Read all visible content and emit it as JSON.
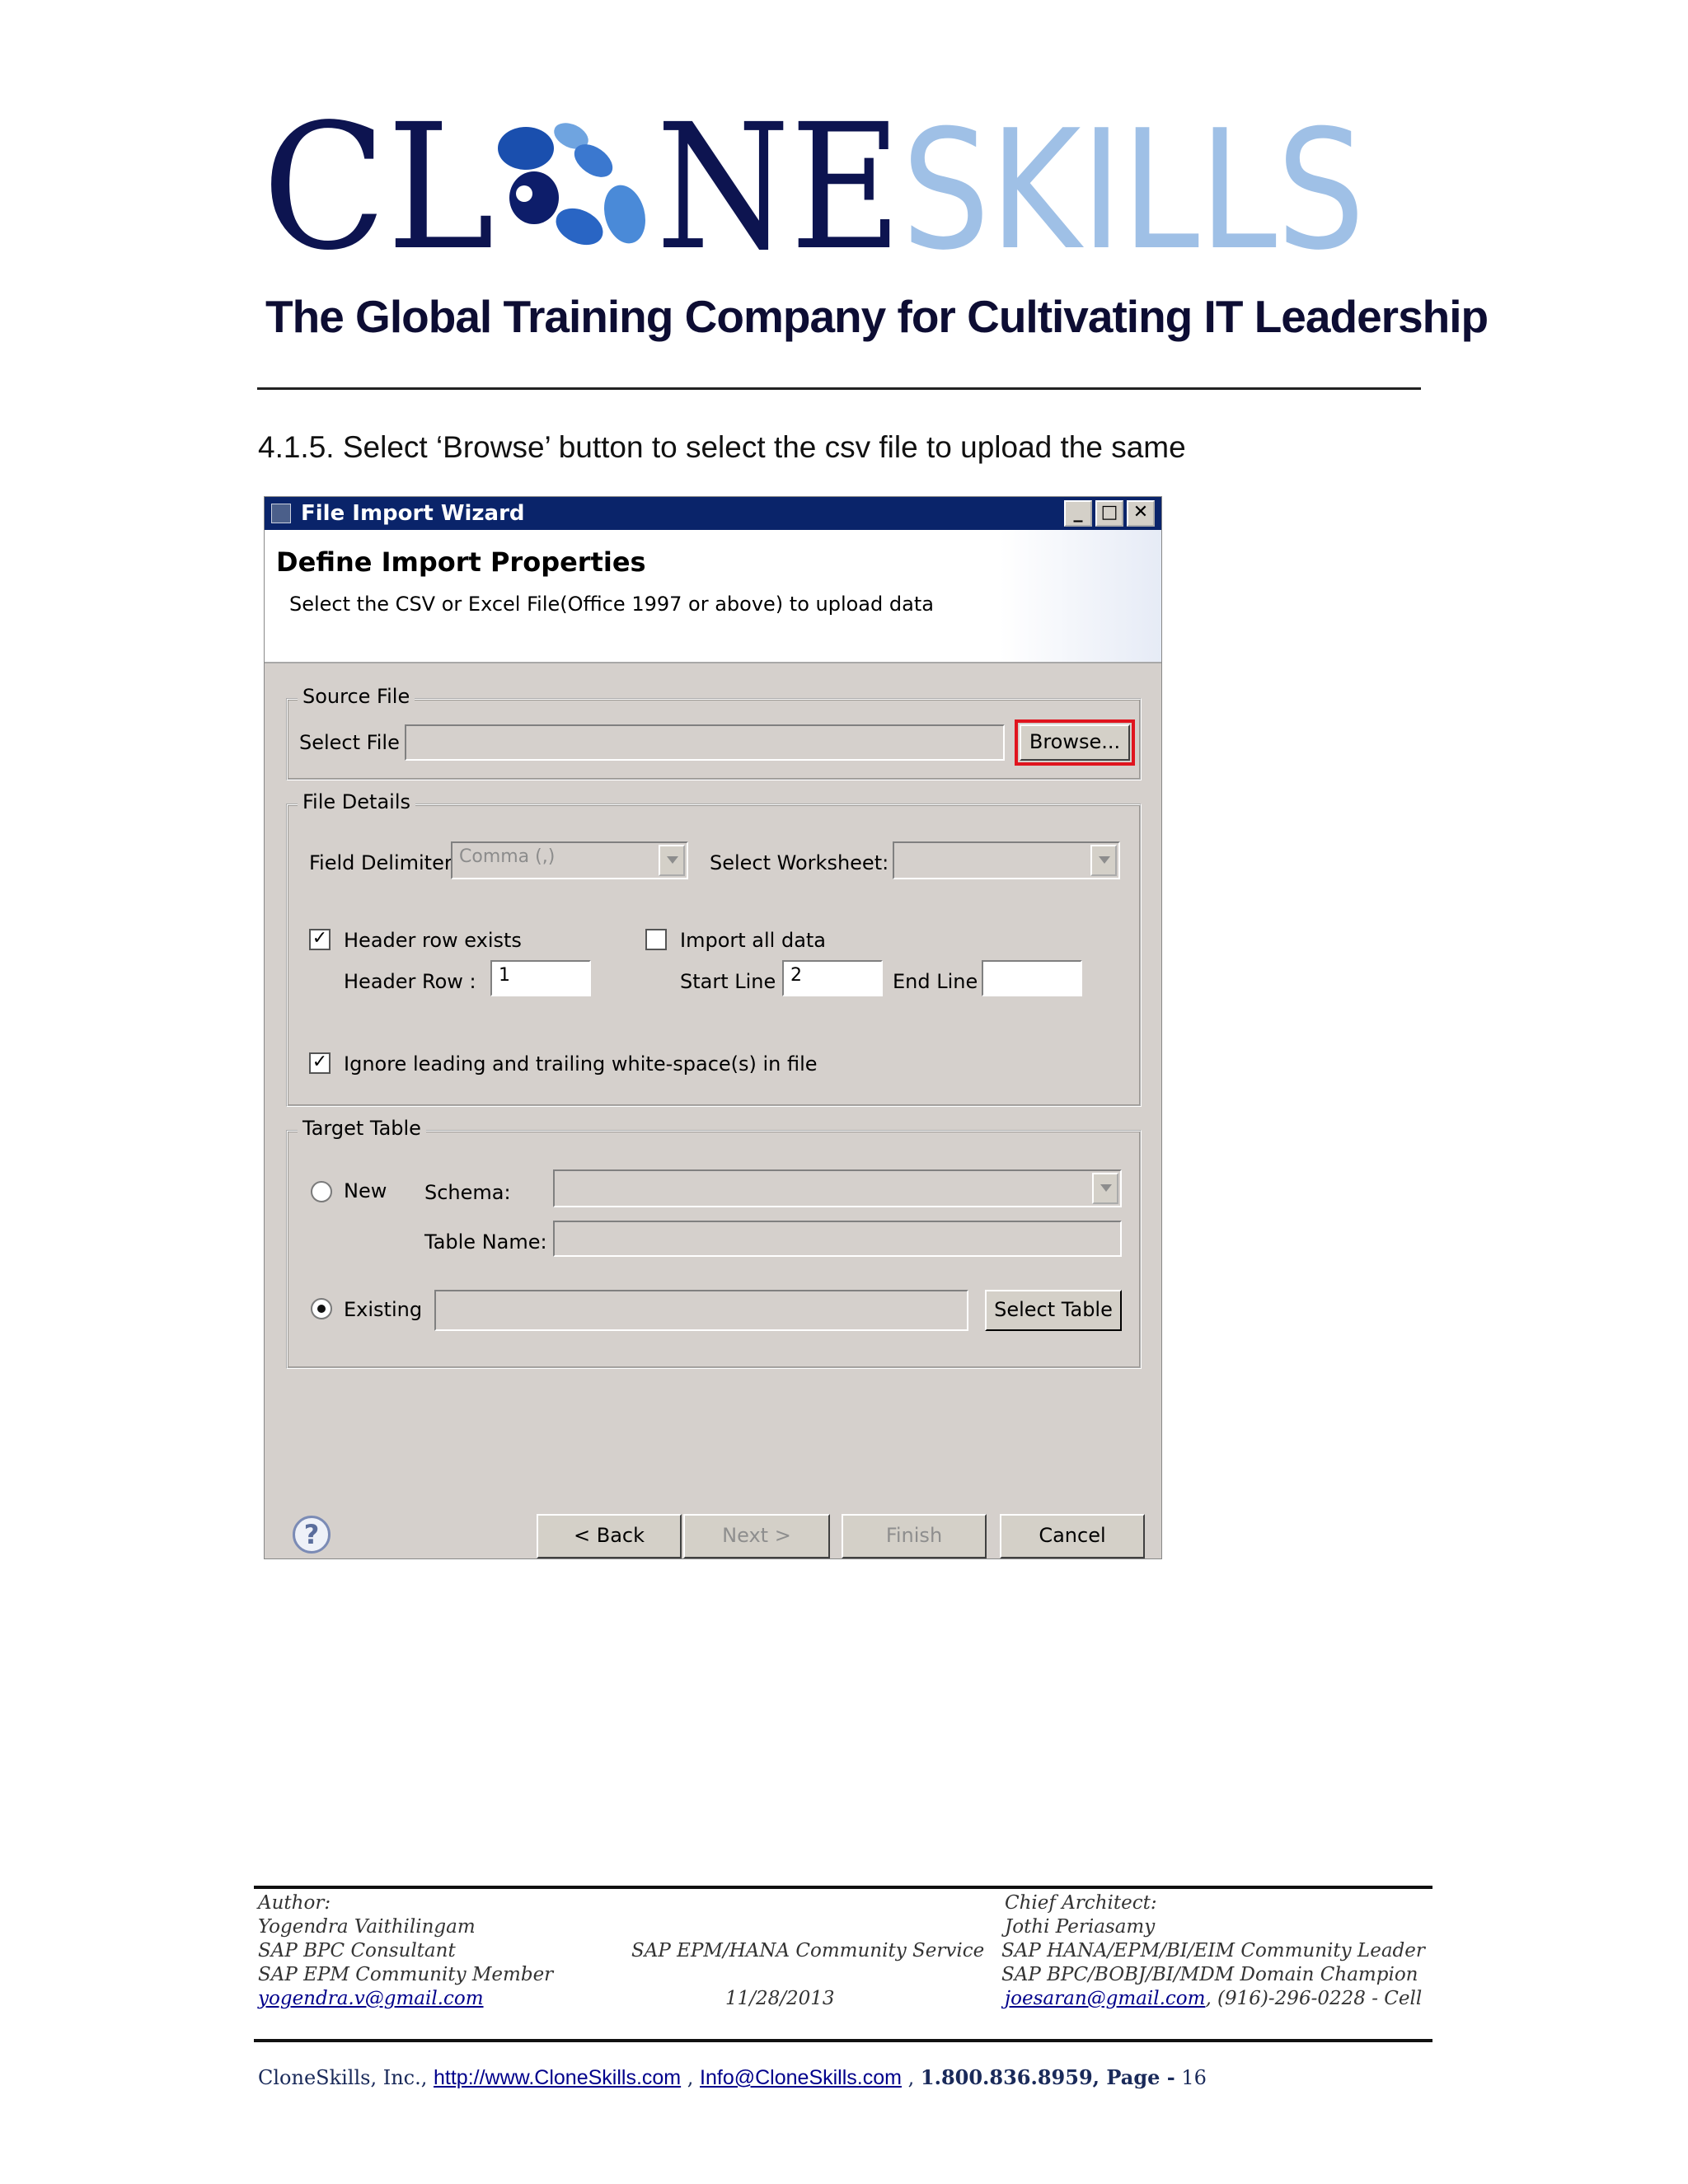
{
  "logo": {
    "text_part1": "CL",
    "text_part2": "NE",
    "text_part3": "SKILLS",
    "dark_color": "#0d1450",
    "light_color": "#9fc0e6"
  },
  "tagline": "The Global Training Company for Cultivating IT Leadership",
  "step_text": "4.1.5. Select ‘Browse’ button to select the csv file to upload the same",
  "wizard": {
    "title": "File Import Wizard",
    "window_buttons": {
      "minimize": "_",
      "maximize": "□",
      "close": "✕"
    },
    "heading": "Define Import Properties",
    "description": "Select the CSV or Excel File(Office 1997 or above) to upload data",
    "source_file": {
      "group_label": "Source File",
      "select_file_label": "Select File",
      "select_file_value": "",
      "browse_label": "Browse..."
    },
    "file_details": {
      "group_label": "File Details",
      "field_delimiter_label": "Field Delimiter",
      "field_delimiter_value": "Comma (,)",
      "select_worksheet_label": "Select Worksheet:",
      "select_worksheet_value": "",
      "header_row_exists_label": "Header row exists",
      "header_row_exists_checked": true,
      "import_all_data_label": "Import all data",
      "import_all_data_checked": false,
      "header_row_label": "Header Row :",
      "header_row_value": "1",
      "start_line_label": "Start Line",
      "start_line_value": "2",
      "end_line_label": "End Line",
      "end_line_value": "",
      "ignore_whitespace_label": "Ignore leading and trailing white-space(s) in file",
      "ignore_whitespace_checked": true
    },
    "target_table": {
      "group_label": "Target Table",
      "new_label": "New",
      "schema_label": "Schema:",
      "table_name_label": "Table Name:",
      "existing_label": "Existing",
      "existing_selected": true,
      "select_table_label": "Select Table"
    },
    "buttons": {
      "back": "< Back",
      "next": "Next >",
      "finish": "Finish",
      "cancel": "Cancel"
    },
    "help_symbol": "?"
  },
  "footer": {
    "author_heading": "Author:",
    "author_name": "Yogendra Vaithilingam",
    "author_role1": "SAP BPC Consultant",
    "author_role2": "SAP EPM Community Member",
    "author_email": "yogendra.v@gmail.com",
    "center_text": "SAP EPM/HANA Community Service",
    "date": "11/28/2013",
    "architect_heading": "Chief Architect:",
    "architect_name": "Jothi Periasamy",
    "architect_role1": "SAP HANA/EPM/BI/EIM Community Leader",
    "architect_role2": "SAP BPC/BOBJ/BI/MDM Domain Champion",
    "architect_email": "joesaran@gmail.com",
    "architect_phone": ", (916)-296-0228 - Cell",
    "company": "CloneSkills, Inc.,",
    "website": "http://www.CloneSkills.com",
    "sep1": ",",
    "email": "Info@CloneSkills.com",
    "sep2": ",",
    "phone_page": "1.800.836.8959, Page -",
    "page_number": "16"
  }
}
